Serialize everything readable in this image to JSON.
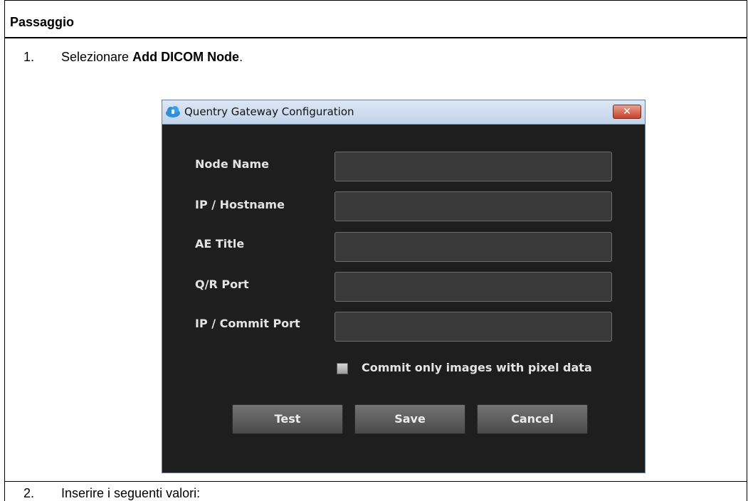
{
  "table": {
    "header": "Passaggio",
    "steps": [
      {
        "number": "1.",
        "text_before": "Selezionare ",
        "bold": "Add DICOM Node",
        "text_after": "."
      },
      {
        "number": "2.",
        "text": "Inserire i seguenti valori:"
      }
    ]
  },
  "dialog": {
    "title": "Quentry Gateway Configuration",
    "close_label": "✕",
    "fields": [
      {
        "label": "Node Name",
        "value": ""
      },
      {
        "label": "IP / Hostname",
        "value": ""
      },
      {
        "label": "AE Title",
        "value": ""
      },
      {
        "label": "Q/R Port",
        "value": ""
      },
      {
        "label": "IP / Commit Port",
        "value": ""
      }
    ],
    "checkbox": {
      "label": "Commit only images with pixel data",
      "checked": false
    },
    "buttons": {
      "test": "Test",
      "save": "Save",
      "cancel": "Cancel"
    },
    "colors": {
      "background": "#1e1e1e",
      "titlebar": "#cddcf0",
      "close": "#c7432b"
    }
  }
}
